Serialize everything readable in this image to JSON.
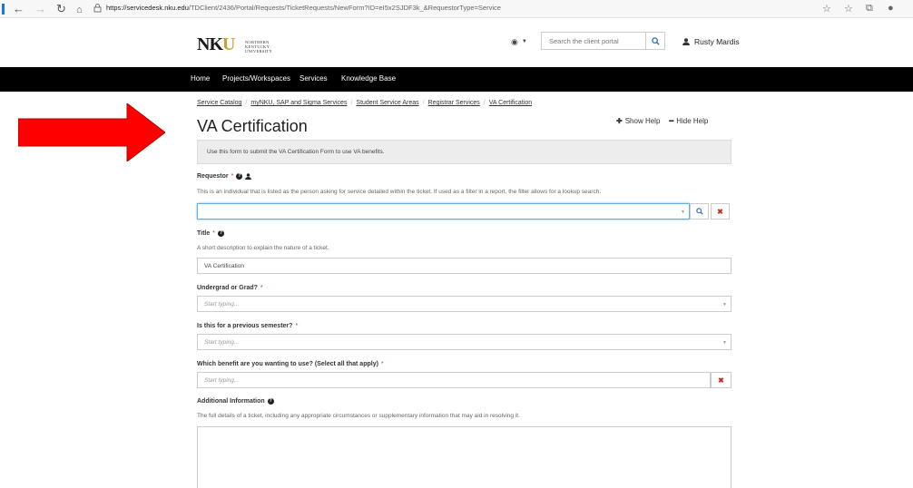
{
  "browser": {
    "url_host": "https://servicedesk.nku.edu",
    "url_path": "/TDClient/2436/Portal/Requests/TicketRequests/NewForm?ID=eI5x2SJDF3k_&RequestorType=Service"
  },
  "header": {
    "logo_text": "NKU",
    "logo_subtext": "NORTHERN KENTUCKY UNIVERSITY",
    "search_placeholder": "Search the client portal",
    "user_name": "Rusty Mardis"
  },
  "nav": {
    "items": [
      "Home",
      "Projects/Workspaces",
      "Services",
      "Knowledge Base"
    ]
  },
  "breadcrumb": [
    "Service Catalog",
    "myNKU, SAP and Sigma Services",
    "Student Service Areas",
    "Registrar Services",
    "VA Certification"
  ],
  "page": {
    "title": "VA Certification",
    "show_help": "Show Help",
    "hide_help": "Hide Help",
    "info": "Use this form to submit the VA Certification Form to use VA benefits."
  },
  "form": {
    "requestor": {
      "label": "Requestor",
      "required": "*",
      "desc": "This is an individual that is listed as the person asking for service detailed within the ticket. If used as a filter in a report, the filter allows for a lookup search.",
      "value": ""
    },
    "title": {
      "label": "Title",
      "required": "*",
      "desc": "A short description to explain the nature of a ticket.",
      "value": "VA Certification"
    },
    "undergrad": {
      "label": "Undergrad or Grad?",
      "required": "*",
      "placeholder": "Start typing..."
    },
    "previous": {
      "label": "Is this for a previous semester?",
      "required": "*",
      "placeholder": "Start typing..."
    },
    "benefit": {
      "label": "Which benefit are you wanting to use? (Select all that apply)",
      "required": "*",
      "placeholder": "Start typing..."
    },
    "additional": {
      "label": "Additional Information",
      "desc": "The full details of a ticket, including any appropriate circumstances or supplementary information that may aid in resolving it."
    }
  },
  "colors": {
    "arrow": "#ff0000",
    "navbar": "#000000",
    "required": "#cc3333"
  }
}
